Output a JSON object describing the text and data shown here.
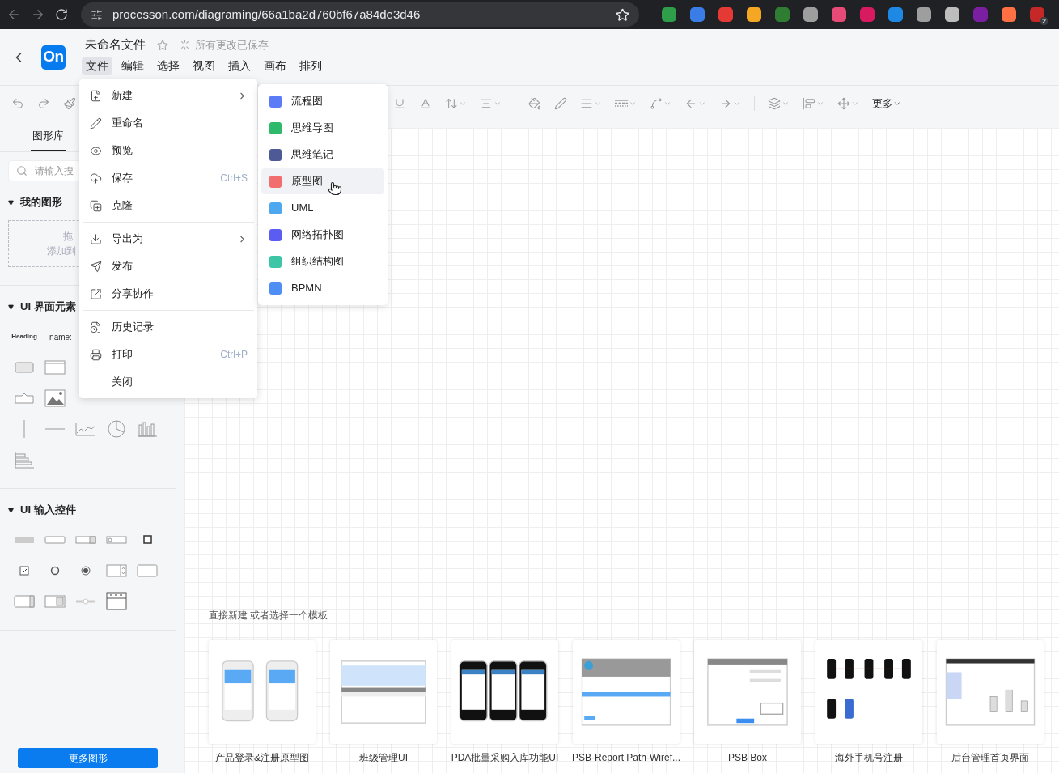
{
  "browser": {
    "url": "processon.com/diagraming/66a1ba2d760bf67a84de3d46",
    "badge": "2"
  },
  "app": {
    "logo": "On",
    "title": "未命名文件",
    "starred": false,
    "save_status": "所有更改已保存"
  },
  "menu_bar": [
    {
      "label": "文件",
      "selected": true
    },
    {
      "label": "编辑",
      "selected": false
    },
    {
      "label": "选择",
      "selected": false
    },
    {
      "label": "视图",
      "selected": false
    },
    {
      "label": "插入",
      "selected": false
    },
    {
      "label": "画布",
      "selected": false
    },
    {
      "label": "排列",
      "selected": false
    }
  ],
  "toolbar": {
    "more": "更多"
  },
  "file_menu": [
    {
      "kind": "item",
      "label": "新建",
      "submenu": true
    },
    {
      "kind": "item",
      "label": "重命名",
      "submenu": false
    },
    {
      "kind": "item",
      "label": "预览",
      "submenu": false
    },
    {
      "kind": "item",
      "label": "保存",
      "submenu": false,
      "shortcut": "Ctrl+S"
    },
    {
      "kind": "item",
      "label": "克隆",
      "submenu": false
    },
    {
      "kind": "divider"
    },
    {
      "kind": "item",
      "label": "导出为",
      "submenu": true
    },
    {
      "kind": "item",
      "label": "发布",
      "submenu": false
    },
    {
      "kind": "item",
      "label": "分享协作",
      "submenu": false
    },
    {
      "kind": "divider"
    },
    {
      "kind": "item",
      "label": "历史记录",
      "submenu": false
    },
    {
      "kind": "item",
      "label": "打印",
      "submenu": false,
      "shortcut": "Ctrl+P"
    },
    {
      "kind": "item",
      "label": "关闭",
      "submenu": false
    }
  ],
  "new_submenu": [
    {
      "label": "流程图",
      "color": "#5b7cf6",
      "selected": false
    },
    {
      "label": "思维导图",
      "color": "#2fba6b",
      "selected": false
    },
    {
      "label": "思维笔记",
      "color": "#4e5a96",
      "selected": false
    },
    {
      "label": "原型图",
      "color": "#f26d6d",
      "selected": true
    },
    {
      "label": "UML",
      "color": "#4ea8f0",
      "selected": false
    },
    {
      "label": "网络拓扑图",
      "color": "#5a5cf2",
      "selected": false
    },
    {
      "label": "组织结构图",
      "color": "#3cc6a5",
      "selected": false
    },
    {
      "label": "BPMN",
      "color": "#4f8ef5",
      "selected": false
    }
  ],
  "sidebar": {
    "tabs": [
      {
        "label": "图形库",
        "selected": true
      }
    ],
    "search": {
      "placeholder": "请输入搜"
    },
    "sections": [
      {
        "kind": "drop",
        "title": "我的图形",
        "expanded": true,
        "drop_text": [
          "拖",
          "添加到"
        ]
      },
      {
        "kind": "ui_elements",
        "title": "UI 界面元素",
        "expanded": true,
        "labels": [
          "Heading",
          "name:"
        ]
      },
      {
        "kind": "ui_inputs",
        "title": "UI 输入控件",
        "expanded": true
      }
    ],
    "more_button": "更多图形"
  },
  "templates": {
    "heading": "直接新建 或者选择一个模板",
    "items": [
      {
        "kind": "phones",
        "name": "产品登录&注册原型图"
      },
      {
        "kind": "table",
        "name": "班级管理UI"
      },
      {
        "kind": "dark_phones",
        "name": "PDA批量采购入库功能UI"
      },
      {
        "kind": "web",
        "name": "PSB-Report Path-Wiref..."
      },
      {
        "kind": "form",
        "name": "PSB Box"
      },
      {
        "kind": "flow",
        "name": "海外手机号注册"
      },
      {
        "kind": "dashboard",
        "name": "后台管理首页界面"
      }
    ]
  }
}
